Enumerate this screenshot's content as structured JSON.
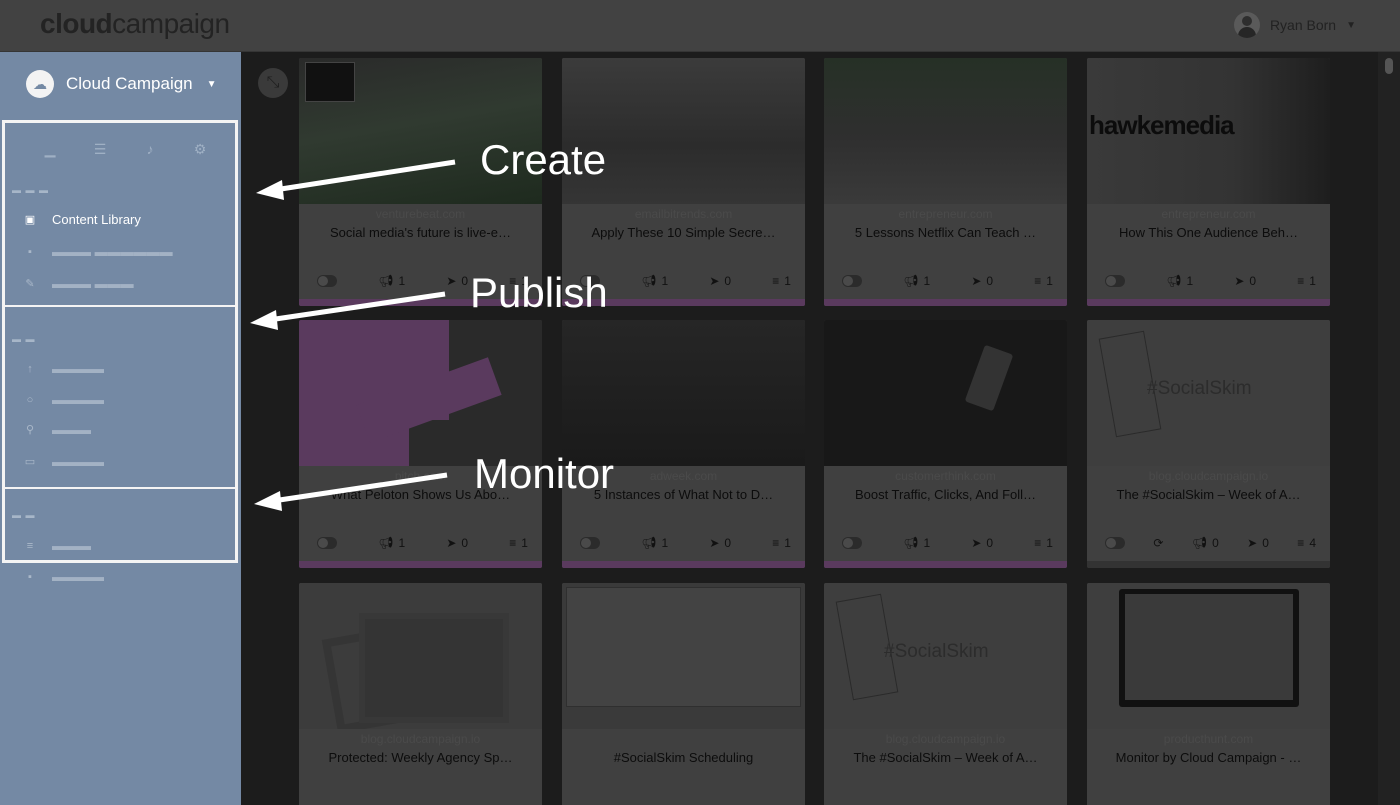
{
  "app": {
    "logo_bold": "cloud",
    "logo_rest": "campaign",
    "user_name": "Ryan Born"
  },
  "sidebar": {
    "brand": "Cloud Campaign",
    "sections": [
      {
        "items": [
          {
            "label": "Content Library",
            "icon": "image-icon",
            "active": true
          }
        ]
      }
    ]
  },
  "annotations": {
    "create": "Create",
    "publish": "Publish",
    "monitor": "Monitor"
  },
  "cards": [
    {
      "domain": "venturebeat.com",
      "title": "Social media's future is live-e…",
      "s1": "1",
      "s2": "0",
      "s3": "1",
      "bar": "#5a3a5e"
    },
    {
      "domain": "emailbitrends.com",
      "title": "Apply These 10 Simple Secre…",
      "s1": "1",
      "s2": "0",
      "s3": "1",
      "bar": "#5a3a5e"
    },
    {
      "domain": "entrepreneur.com",
      "title": "5 Lessons Netflix Can Teach …",
      "s1": "1",
      "s2": "0",
      "s3": "1",
      "bar": "#5a3a5e"
    },
    {
      "domain": "entrepreneur.com",
      "title": "How This One Audience Beh…",
      "s1": "1",
      "s2": "0",
      "s3": "1",
      "bar": "#5a3a5e"
    },
    {
      "domain": "pitch.com",
      "title": "What Peloton Shows Us Abo…",
      "s1": "1",
      "s2": "0",
      "s3": "1",
      "bar": "#5a3a5e"
    },
    {
      "domain": "adweek.com",
      "title": "5 Instances of What Not to D…",
      "s1": "1",
      "s2": "0",
      "s3": "1",
      "bar": "#5a3a5e"
    },
    {
      "domain": "customerthink.com",
      "title": "Boost Traffic, Clicks, And Foll…",
      "s1": "1",
      "s2": "0",
      "s3": "1",
      "bar": "#5a3a5e"
    },
    {
      "domain": "blog.cloudcampaign.io",
      "title": "The #SocialSkim – Week of A…",
      "s1": "0",
      "s2": "0",
      "s3": "4",
      "bar": "#333333"
    },
    {
      "domain": "blog.cloudcampaign.io",
      "title": "Protected: Weekly Agency Sp…",
      "s1": "",
      "s2": "",
      "s3": "",
      "bar": "#5a3a5e"
    },
    {
      "domain": "",
      "title": "#SocialSkim Scheduling",
      "s1": "",
      "s2": "",
      "s3": "",
      "bar": "#5a3a5e"
    },
    {
      "domain": "blog.cloudcampaign.io",
      "title": "The #SocialSkim – Week of A…",
      "s1": "",
      "s2": "",
      "s3": "",
      "bar": "#5a3a5e"
    },
    {
      "domain": "producthunt.com",
      "title": "Monitor by Cloud Campaign - …",
      "s1": "",
      "s2": "",
      "s3": "",
      "bar": "#5a3a5e"
    }
  ],
  "thumbnails": {
    "hawke_text": "hawkemedia",
    "skim_text": "#SocialSkim"
  }
}
